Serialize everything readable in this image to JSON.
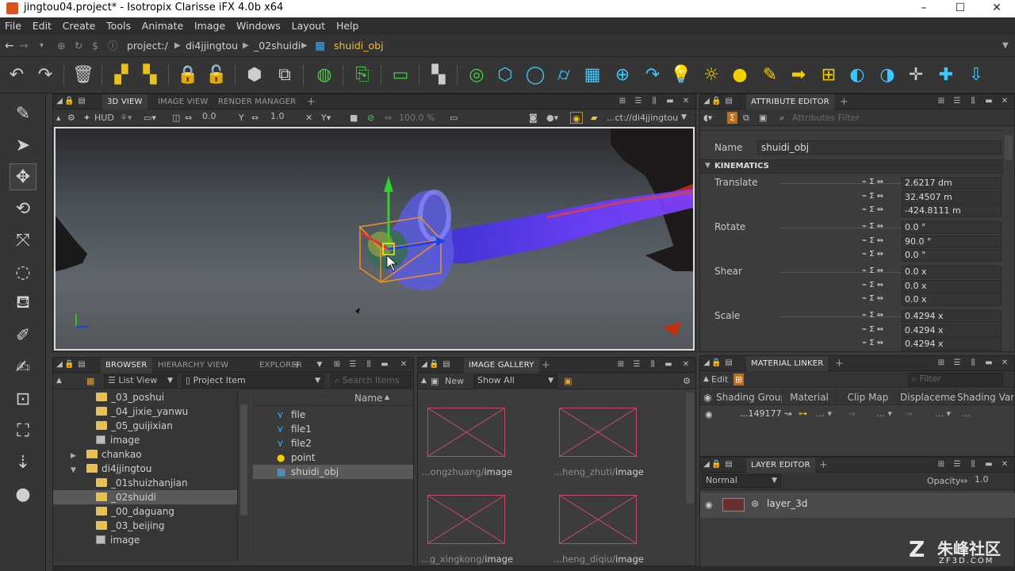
{
  "window": {
    "title": "jingtou04.project* - Isotropix Clarisse iFX 4.0b x64",
    "controls": [
      "–",
      "☐",
      "✕"
    ]
  },
  "menu": [
    "File",
    "Edit",
    "Create",
    "Tools",
    "Animate",
    "Image",
    "Windows",
    "Layout",
    "Help"
  ],
  "pathbar": {
    "crumbs": [
      "project:/",
      "di4jjingtou",
      "_02shuidi"
    ],
    "current": "shuidi_obj"
  },
  "viewport_panel": {
    "tabs": [
      "3D VIEW",
      "IMAGE VIEW",
      "RENDER MANAGER"
    ],
    "hud_label": "HUD",
    "field1": "0.0",
    "field2": "1.0",
    "percent": "100.0 %",
    "path": "...ct://di4jjingtou"
  },
  "attribute_editor": {
    "tab": "ATTRIBUTE EDITOR",
    "filter_placeholder": "Attributes Filter",
    "name_label": "Name",
    "name_value": "shuidi_obj",
    "section": "KINEMATICS",
    "groups": [
      {
        "label": "Translate",
        "values": [
          "2.6217 dm",
          "32.4507 m",
          "-424.8111 m"
        ]
      },
      {
        "label": "Rotate",
        "values": [
          "0.0 °",
          "90.0 °",
          "0.0 °"
        ]
      },
      {
        "label": "Shear",
        "values": [
          "0.0 x",
          "0.0 x",
          "0.0 x"
        ]
      },
      {
        "label": "Scale",
        "values": [
          "0.4294 x",
          "0.4294 x",
          "0.4294 x"
        ]
      }
    ]
  },
  "browser": {
    "tabs": [
      "BROWSER",
      "HIERARCHY VIEW",
      "EXPLORER"
    ],
    "view_mode": "List View",
    "item_type": "Project Item",
    "search_placeholder": "Search Items",
    "column_header": "Name",
    "tree": [
      {
        "label": "_03_poshui",
        "kind": "folder",
        "depth": 2
      },
      {
        "label": "_04_jixie_yanwu",
        "kind": "folder",
        "depth": 2
      },
      {
        "label": "_05_guijixian",
        "kind": "folder",
        "depth": 2
      },
      {
        "label": "image",
        "kind": "image",
        "depth": 2
      },
      {
        "label": "chankao",
        "kind": "folder",
        "depth": 1,
        "collapsed": true
      },
      {
        "label": "di4jjingtou",
        "kind": "folder",
        "depth": 1,
        "expanded": true
      },
      {
        "label": "_01shuizhanjian",
        "kind": "folder",
        "depth": 2
      },
      {
        "label": "_02shuidi",
        "kind": "folder",
        "depth": 2,
        "selected": true
      },
      {
        "label": "_00_daguang",
        "kind": "folder",
        "depth": 2
      },
      {
        "label": "_03_beijing",
        "kind": "folder",
        "depth": 2
      },
      {
        "label": "image",
        "kind": "image",
        "depth": 2
      }
    ],
    "items": [
      {
        "label": "file",
        "icon": "particle-icon"
      },
      {
        "label": "file1",
        "icon": "particle-icon"
      },
      {
        "label": "file2",
        "icon": "particle-icon"
      },
      {
        "label": "point",
        "icon": "light-icon"
      },
      {
        "label": "shuidi_obj",
        "icon": "mesh-icon",
        "selected": true
      }
    ]
  },
  "image_gallery": {
    "tab": "IMAGE GALLERY",
    "new_label": "New",
    "filter": "Show All",
    "thumbs": [
      {
        "prefix": "...ongzhuang/",
        "name": "image"
      },
      {
        "prefix": "...heng_zhuti/",
        "name": "image"
      },
      {
        "prefix": "...g_xingkong/",
        "name": "image"
      },
      {
        "prefix": "...heng_diqiu/",
        "name": "image"
      }
    ]
  },
  "material_linker": {
    "tab": "MATERIAL LINKER",
    "edit_label": "Edit",
    "filter_placeholder": "Filter",
    "columns": [
      "Shading Group",
      "Material",
      "Clip Map",
      "Displacement",
      "Shading Variables"
    ],
    "row_value": "...149177"
  },
  "layer_editor": {
    "tab": "LAYER EDITOR",
    "blend_mode": "Normal",
    "opacity_label": "Opacity",
    "opacity_value": "1.0",
    "layer_name": "layer_3d"
  },
  "watermark": {
    "brand": "朱峰社区",
    "url": "ZF3D.COM"
  },
  "colors": {
    "accent_yellow": "#f0d000",
    "accent_cyan": "#3cc8ff",
    "accent_green": "#4ec94e",
    "selection": "#595959",
    "panel_bg": "#3c3c3c"
  }
}
